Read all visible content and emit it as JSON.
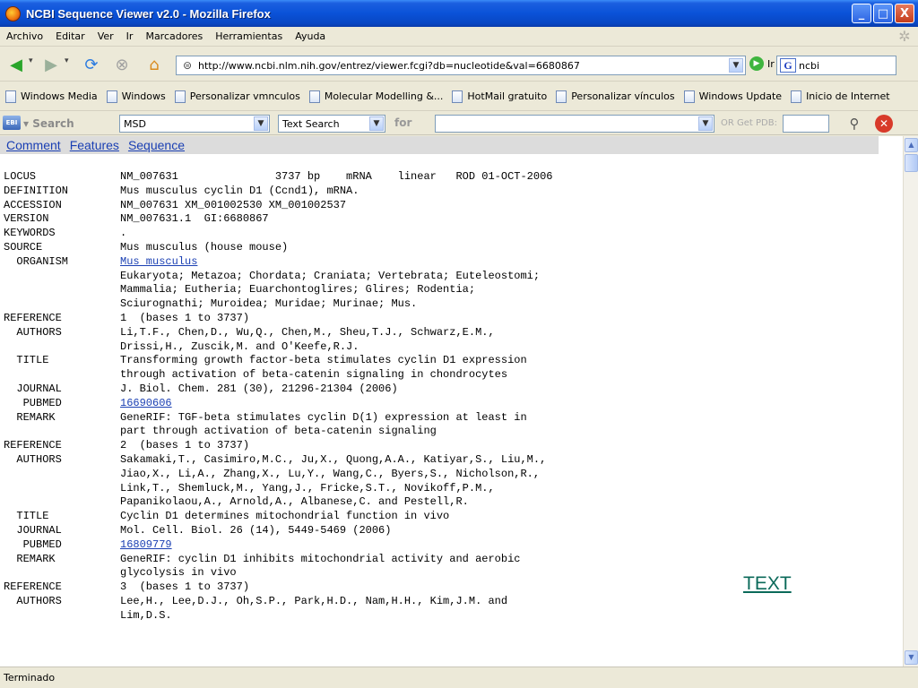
{
  "window": {
    "title": "NCBI Sequence Viewer v2.0 - Mozilla Firefox",
    "minimize": "_",
    "maximize": "□",
    "close": "X"
  },
  "menu": {
    "items": [
      "Archivo",
      "Editar",
      "Ver",
      "Ir",
      "Marcadores",
      "Herramientas",
      "Ayuda"
    ]
  },
  "nav": {
    "url": "http://www.ncbi.nlm.nih.gov/entrez/viewer.fcgi?db=nucleotide&val=6680867",
    "go_label": "Ir",
    "search_value": "ncbi"
  },
  "bookmarks": {
    "items": [
      "Windows Media",
      "Windows",
      "Personalizar vmnculos",
      "Molecular Modelling &...",
      "HotMail gratuito",
      "Personalizar vínculos",
      "Windows Update",
      "Inicio de Internet"
    ]
  },
  "ncbi_toolbar": {
    "search_label": "Search",
    "db_value": "MSD",
    "mode_value": "Text Search",
    "for_label": "for",
    "or_get_pdb": "OR Get PDB:"
  },
  "content": {
    "tabs": [
      "Comment",
      "Features",
      "Sequence"
    ],
    "text_link": "TEXT",
    "lines": [
      {
        "k": "LOCUS",
        "v": "NM_007631               3737 bp    mRNA    linear   ROD 01-OCT-2006"
      },
      {
        "k": "DEFINITION",
        "v": "Mus musculus cyclin D1 (Ccnd1), mRNA."
      },
      {
        "k": "ACCESSION",
        "v": "NM_007631 XM_001002530 XM_001002537"
      },
      {
        "k": "VERSION",
        "v": "NM_007631.1  GI:6680867"
      },
      {
        "k": "KEYWORDS",
        "v": "."
      },
      {
        "k": "SOURCE",
        "v": "Mus musculus (house mouse)"
      },
      {
        "k": "  ORGANISM",
        "v": "Mus musculus",
        "link": true
      },
      {
        "k": "",
        "v": "Eukaryota; Metazoa; Chordata; Craniata; Vertebrata; Euteleostomi;"
      },
      {
        "k": "",
        "v": "Mammalia; Eutheria; Euarchontoglires; Glires; Rodentia;"
      },
      {
        "k": "",
        "v": "Sciurognathi; Muroidea; Muridae; Murinae; Mus."
      },
      {
        "k": "REFERENCE",
        "v": "1  (bases 1 to 3737)"
      },
      {
        "k": "  AUTHORS",
        "v": "Li,T.F., Chen,D., Wu,Q., Chen,M., Sheu,T.J., Schwarz,E.M.,"
      },
      {
        "k": "",
        "v": "Drissi,H., Zuscik,M. and O'Keefe,R.J."
      },
      {
        "k": "  TITLE",
        "v": "Transforming growth factor-beta stimulates cyclin D1 expression"
      },
      {
        "k": "",
        "v": "through activation of beta-catenin signaling in chondrocytes"
      },
      {
        "k": "  JOURNAL",
        "v": "J. Biol. Chem. 281 (30), 21296-21304 (2006)"
      },
      {
        "k": "   PUBMED",
        "v": "16690606",
        "link": true
      },
      {
        "k": "  REMARK",
        "v": "GeneRIF: TGF-beta stimulates cyclin D(1) expression at least in"
      },
      {
        "k": "",
        "v": "part through activation of beta-catenin signaling"
      },
      {
        "k": "REFERENCE",
        "v": "2  (bases 1 to 3737)"
      },
      {
        "k": "  AUTHORS",
        "v": "Sakamaki,T., Casimiro,M.C., Ju,X., Quong,A.A., Katiyar,S., Liu,M.,"
      },
      {
        "k": "",
        "v": "Jiao,X., Li,A., Zhang,X., Lu,Y., Wang,C., Byers,S., Nicholson,R.,"
      },
      {
        "k": "",
        "v": "Link,T., Shemluck,M., Yang,J., Fricke,S.T., Novikoff,P.M.,"
      },
      {
        "k": "",
        "v": "Papanikolaou,A., Arnold,A., Albanese,C. and Pestell,R."
      },
      {
        "k": "  TITLE",
        "v": "Cyclin D1 determines mitochondrial function in vivo"
      },
      {
        "k": "  JOURNAL",
        "v": "Mol. Cell. Biol. 26 (14), 5449-5469 (2006)"
      },
      {
        "k": "   PUBMED",
        "v": "16809779",
        "link": true
      },
      {
        "k": "  REMARK",
        "v": "GeneRIF: cyclin D1 inhibits mitochondrial activity and aerobic"
      },
      {
        "k": "",
        "v": "glycolysis in vivo"
      },
      {
        "k": "REFERENCE",
        "v": "3  (bases 1 to 3737)"
      },
      {
        "k": "  AUTHORS",
        "v": "Lee,H., Lee,D.J., Oh,S.P., Park,H.D., Nam,H.H., Kim,J.M. and"
      },
      {
        "k": "",
        "v": "Lim,D.S."
      }
    ]
  },
  "status": {
    "text": "Terminado"
  }
}
